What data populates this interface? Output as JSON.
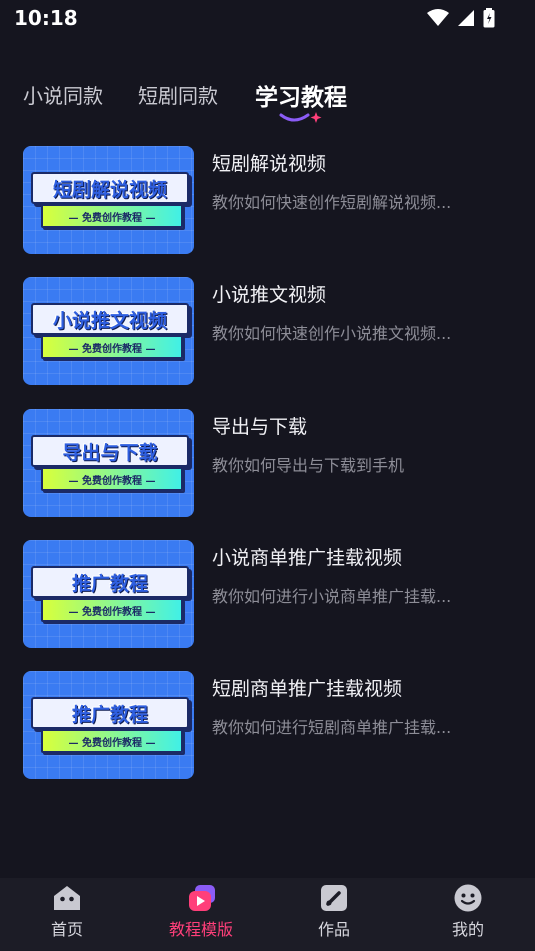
{
  "status_bar": {
    "time": "10:18"
  },
  "tabs": [
    {
      "label": "小说同款"
    },
    {
      "label": "短剧同款"
    },
    {
      "label": "学习教程"
    }
  ],
  "tutorials": [
    {
      "thumb_title": "短剧解说视频",
      "thumb_ribbon": "— 免费创作教程 —",
      "title": "短剧解说视频",
      "desc": "教你如何快速创作短剧解说视频..."
    },
    {
      "thumb_title": "小说推文视频",
      "thumb_ribbon": "— 免费创作教程 —",
      "title": "小说推文视频",
      "desc": "教你如何快速创作小说推文视频..."
    },
    {
      "thumb_title": "导出与下载",
      "thumb_ribbon": "— 免费创作教程 —",
      "title": "导出与下载",
      "desc": "教你如何导出与下载到手机"
    },
    {
      "thumb_title": "推广教程",
      "thumb_ribbon": "— 免费创作教程 —",
      "title": "小说商单推广挂载视频",
      "desc": "教你如何进行小说商单推广挂载..."
    },
    {
      "thumb_title": "推广教程",
      "thumb_ribbon": "— 免费创作教程 —",
      "title": "短剧商单推广挂载视频",
      "desc": "教你如何进行短剧商单推广挂载..."
    }
  ],
  "bottom_nav": [
    {
      "label": "首页",
      "icon": "home-icon"
    },
    {
      "label": "教程模版",
      "icon": "template-icon"
    },
    {
      "label": "作品",
      "icon": "works-icon"
    },
    {
      "label": "我的",
      "icon": "profile-icon"
    }
  ],
  "colors": {
    "background": "#15151f",
    "accent": "#ff3f7a",
    "thumb_blue": "#3a7bf2"
  }
}
